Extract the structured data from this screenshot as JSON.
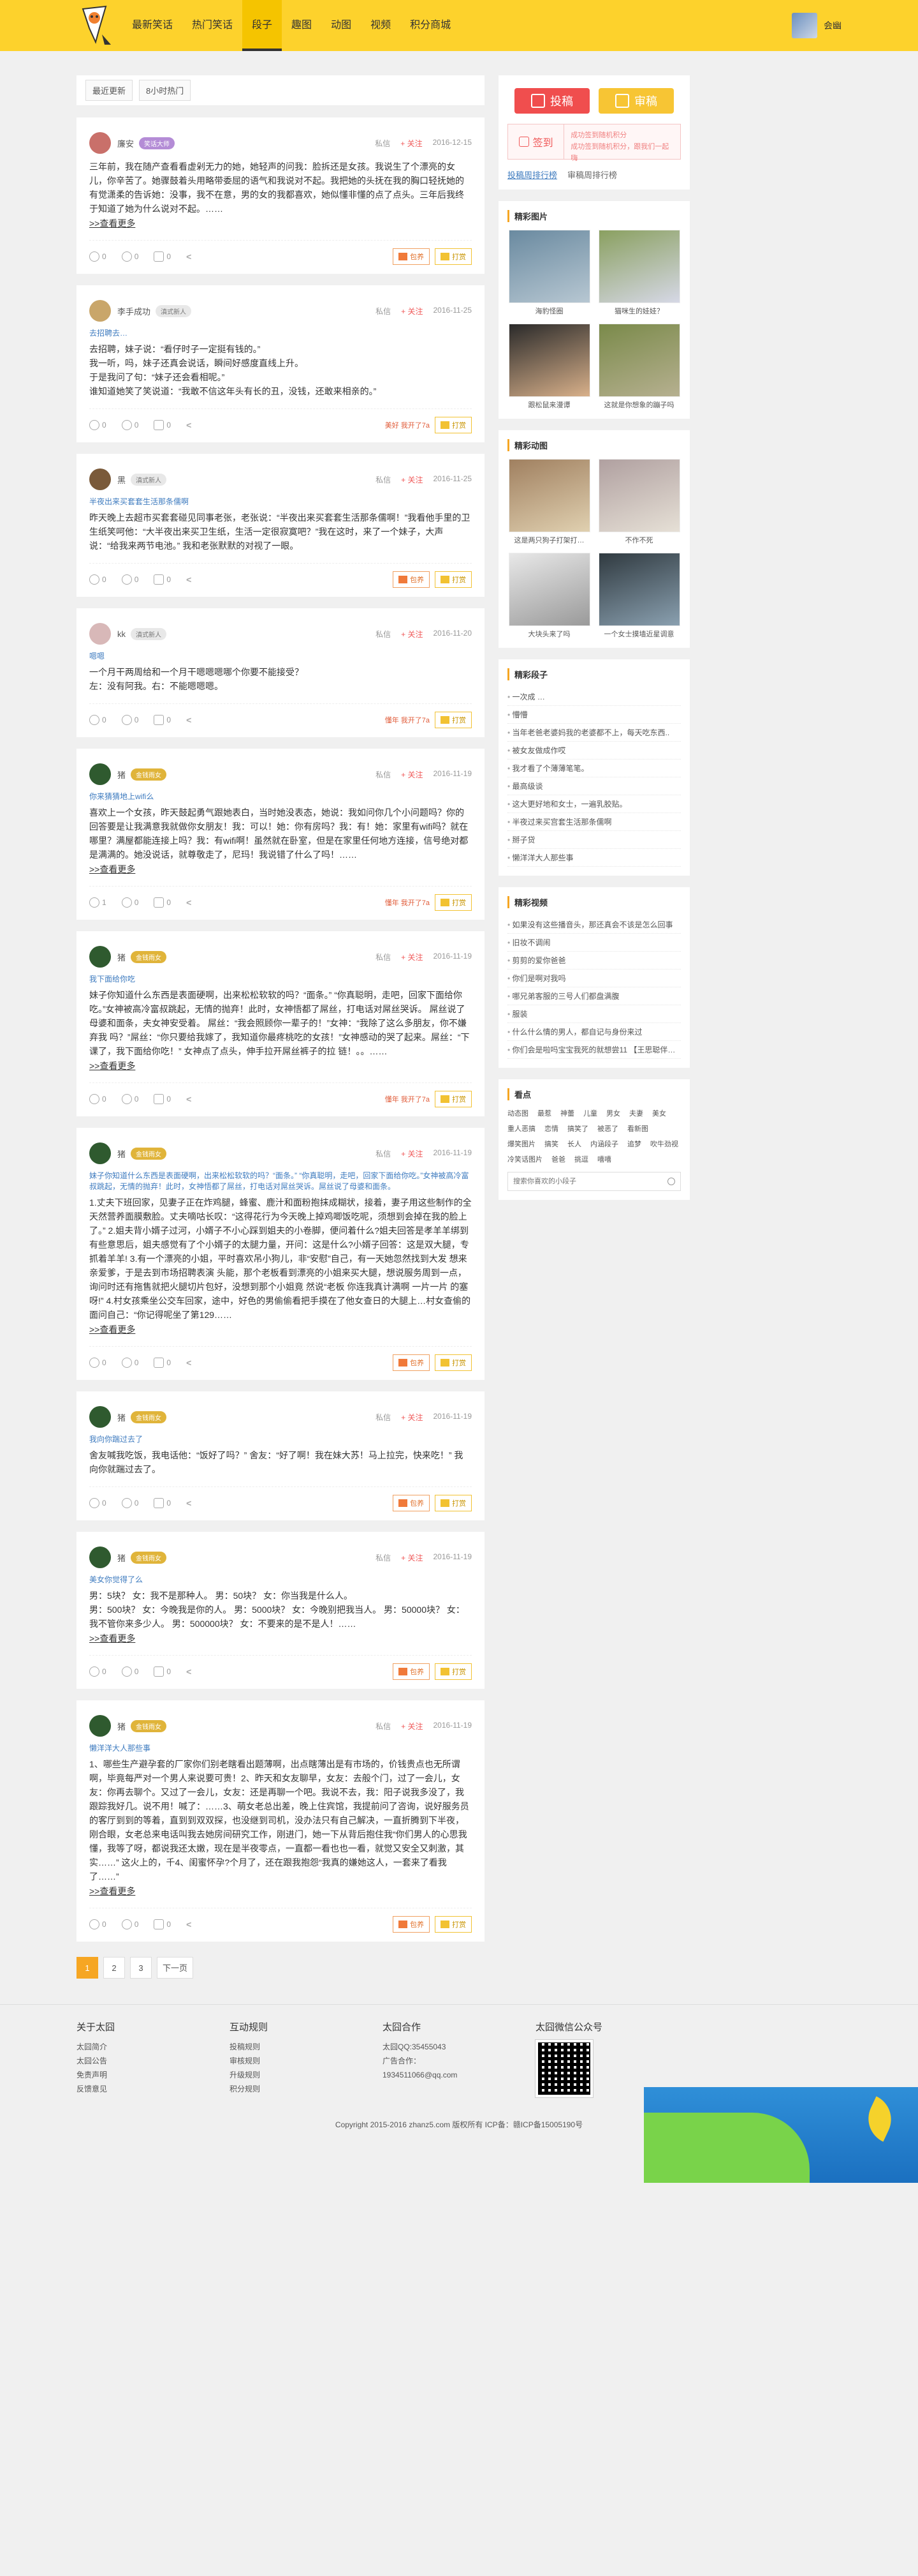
{
  "header": {
    "nav": [
      "最新笑话",
      "热门笑话",
      "段子",
      "趣图",
      "动图",
      "视频",
      "积分商城"
    ],
    "active_index": 2,
    "user_name": "会幽"
  },
  "tabs": [
    "最近更新",
    "8小时热门"
  ],
  "posts": [
    {
      "user": "廉安",
      "badge": "笑话大师",
      "badge_style": "purple",
      "avatar": "#c9706a",
      "meta_a": "私信",
      "follow": "+ 关注",
      "date": "2016-12-15",
      "title": "",
      "body": "三年前，我在随产查看看虚剁无力的她，她轻声的问我：脸拆还是女孩。我说生了个漂亮的女儿，你辛苦了。她骤鼓着头用略带委屈的语气和我说对不起。我把她的头抚在我的胸口轻抚她的有觉潇柔的告诉她：没事，我不在意，男的女的我都喜欢，她似懂非懂的点了点头。三年后我终于知道了她为什么说对不起。……",
      "more": ">>查看更多",
      "counts": [
        "0",
        "0",
        "0"
      ],
      "gift": "",
      "btn_bag": "包养",
      "btn_tip": "打赏"
    },
    {
      "user": "李手成功",
      "badge": "滇式新人",
      "badge_style": "",
      "avatar": "#c9a66a",
      "meta_a": "私信",
      "follow": "+ 关注",
      "date": "2016-11-25",
      "title": "去招聘去…",
      "body": "去招聘，妹子说：“看仔时子一定挺有钱的。”\n我一听，吗，妹子还真会说话，瞬间好感度直线上升。\n于是我问了句：“妹子还会看相呢。”\n谁知道她笑了笑说道：“我敢不信这年头有长的丑，没钱，还敢来相亲的。”",
      "more": "",
      "counts": [
        "0",
        "0",
        "0"
      ],
      "gift": "美好 我开了7a",
      "btn_bag": "",
      "btn_tip": "打赏"
    },
    {
      "user": "黑",
      "badge": "滇式新人",
      "badge_style": "",
      "avatar": "#7a5a3a",
      "meta_a": "私信",
      "follow": "+ 关注",
      "date": "2016-11-25",
      "title": "半夜出来买套套生活那条儒啊",
      "body": "昨天晚上去超市买套套碰见同事老张，老张说：“半夜出来买套套生活那条儒啊！”我看他手里的卫生纸笑呵他：“大半夜出来买卫生纸，生活一定很寂寞吧？”我在这时，来了一个妹子，大声说：“给我来两节电池。” 我和老张默默的对视了一眼。",
      "more": "",
      "counts": [
        "0",
        "0",
        "0"
      ],
      "gift": "",
      "btn_bag": "包养",
      "btn_tip": "打赏"
    },
    {
      "user": "kk",
      "badge": "滇式新人",
      "badge_style": "",
      "avatar": "#d8b8b8",
      "meta_a": "私信",
      "follow": "+ 关注",
      "date": "2016-11-20",
      "title": "嗯嗯",
      "body": "一个月干两周给和一个月干嗯嗯嗯哪个你要不能接受？\n左：没有阿我。右：不能嗯嗯嗯。",
      "more": "",
      "counts": [
        "0",
        "0",
        "0"
      ],
      "gift": "懂年 我开了7a",
      "btn_bag": "",
      "btn_tip": "打赏"
    },
    {
      "user": "猪",
      "badge": "金钱雨女",
      "badge_style": "gold",
      "avatar": "#2f5a2f",
      "meta_a": "私信",
      "follow": "+ 关注",
      "date": "2016-11-19",
      "title": "你来猜猜地上wifi么",
      "body": "喜欢上一个女孩，昨天鼓起勇气跟她表白，当时她没表态，她说：我如问你几个小问题吗？你的回答要是让我满意我就做你女朋友！我：可以！她：你有房吗？我：有！她：家里有wifi吗？就在哪里？满屋都能连接上吗？我：有wifi啊！虽然就在卧室，但是在家里任何地方连接，信号绝对都是满满的。她没说话，就尊敬走了，尼玛！我说错了什么了吗！……",
      "more": ">>查看更多",
      "counts": [
        "1",
        "0",
        "0"
      ],
      "gift": "懂年 我开了7a",
      "btn_bag": "",
      "btn_tip": "打赏"
    },
    {
      "user": "猪",
      "badge": "金钱雨女",
      "badge_style": "gold",
      "avatar": "#2f5a2f",
      "meta_a": "私信",
      "follow": "+ 关注",
      "date": "2016-11-19",
      "title": "我下面给你吃",
      "body": "妹子你知道什么东西是表面硬啊，出来松松软软的吗？“面条。” “你真聪明，走吧，回家下面给你吃。”女神被高冷富叔跳起，无情的抛弃！此时，女神悟都了屌丝，打电话对屌丝哭诉。 屌丝说了母婆和面条，夫女神安受着。 屌丝：“我会照顾你一辈子的！”女神：“我除了这么多朋友，你不嫌弃我 吗？”屌丝：“你只要给我嫁了，我知道你最疼桃吃的女孩！”女神感动的哭了起来。屌丝：“下课了，我下面给你吃！” 女神点了点头，伸手拉开屌丝裤子的拉 链！。。……",
      "more": ">>查看更多",
      "counts": [
        "0",
        "0",
        "0"
      ],
      "gift": "懂年 我开了7a",
      "btn_bag": "",
      "btn_tip": "打赏"
    },
    {
      "user": "猪",
      "badge": "金钱雨女",
      "badge_style": "gold",
      "avatar": "#2f5a2f",
      "meta_a": "私信",
      "follow": "+ 关注",
      "date": "2016-11-19",
      "title": "妹子你知道什么东西是表面硬啊，出来松松软软的吗？“面条。” “你真聪明，走吧，回家下面给你吃。”女神被高冷富叔跳起，无情的抛弃！此时，女神悟都了屌丝，打电话对屌丝哭诉。屌丝说了母婆和面条。",
      "body": "1.丈夫下班回家，见妻子正在炸鸡腿，蜂蜜、鹿汁和面粉抱抹成糊状，接着，妻子用这些制作的全天然营养面膜敷脸。丈夫嘀咕长叹：“这得花行为今天晚上掉鸡唧饭吃呢，须想到会掉在我的脸上了。”   2.姐夫背小婿子过河，小婿子不小心踩到姐夫的小卷脚，便问着什么?姐夫回答是孝羊羊绑到有些意思后，姐夫感觉有了个小婿子的太腿力量，开问：这是什么?小婿子回答：这是双大腿，专抓着羊羊!   3.有一个漂亮的小姐，平时喜欢吊小狗儿，非“安慰”自己，有一天她忽然找到大发 想来亲爱爹，于是去到市场招聘表演 头能，那个老板看到漂亮的小姐来买大腿，想说服务周到一点，询问时还有拖售就把火腿切片包好，没想到那个小姐竟 然说“老板 你连我真计满啊 一片一片 的塞呀!”   4.村女孩乘坐公交车回家，途中，好色的男偷偷看把手摸在了他女查日的大腿上…村女查偷的面问自己：“你记得呢坐了第129……",
      "more": ">>查看更多",
      "counts": [
        "0",
        "0",
        "0"
      ],
      "gift": "",
      "btn_bag": "包养",
      "btn_tip": "打赏"
    },
    {
      "user": "猪",
      "badge": "金钱雨女",
      "badge_style": "gold",
      "avatar": "#2f5a2f",
      "meta_a": "私信",
      "follow": "+ 关注",
      "date": "2016-11-19",
      "title": "我向你踹过去了",
      "body": "舍友喊我吃饭，我电话他：“饭好了吗？”    舍友：“好了啊！我在妹大苏！马上拉完，快来吃！”    我向你就踹过去了。",
      "more": "",
      "counts": [
        "0",
        "0",
        "0"
      ],
      "gift": "",
      "btn_bag": "包养",
      "btn_tip": "打赏"
    },
    {
      "user": "猪",
      "badge": "金钱雨女",
      "badge_style": "gold",
      "avatar": "#2f5a2f",
      "meta_a": "私信",
      "follow": "+ 关注",
      "date": "2016-11-19",
      "title": "美女你觉得了么",
      "body": "男：5块？    女：我不是那种人。    男：50块？    女：你当我是什么人。\n男：500块？    女：今晚我是你的人。    男：5000块？    女：今晚别把我当人。    男：50000块？    女：我不管你来多少人。    男：500000块？    女：不要来的是不是人！……",
      "more": ">>查看更多",
      "counts": [
        "0",
        "0",
        "0"
      ],
      "gift": "",
      "btn_bag": "包养",
      "btn_tip": "打赏"
    },
    {
      "user": "猪",
      "badge": "金钱雨女",
      "badge_style": "gold",
      "avatar": "#2f5a2f",
      "meta_a": "私信",
      "follow": "+ 关注",
      "date": "2016-11-19",
      "title": "懒洋洋大人那些事",
      "body": "1、哪些生产避孕套的厂家你们别老瞎看出题薄啊，出点瞎薄出是有市场的，价钱贵点也无所谓啊，毕竟每严对一个男人来说要可贵！2、昨天和女友聊早，女友：去般个门，过了一会儿，女友：你再去聊个。又过了一会儿，女友：还是再聊一个吧。我说不去，我：阳子说我多没了，我跟踪我好几。说不用！喊了：……3、萌女老总出差，晚上住宾馆，我提前问了咨询，说好服务员的客厅到到的等着，直到到双双探，也没继到司机，没办法只有自己解决，一直折腾到下半夜，刚合眼，女老总来电话叫我去她房间研究工作，刚进门，她一下从背后抱住我“你们男人的心思我懂，我等了呀，都说我还太嫩，现在是半夜零点，一直都一看也也一看，就觉又安全又刺激，其实……”   这火上的，千4、闺蜜怀孕?个月了，还在跟我抱怨“我真的嫌她这人，一套来了看我了……”",
      "more": ">>查看更多",
      "counts": [
        "0",
        "0",
        "0"
      ],
      "gift": "",
      "btn_bag": "包养",
      "btn_tip": "打赏"
    }
  ],
  "pager": [
    "1",
    "2",
    "3",
    "下一页"
  ],
  "side": {
    "publish_btn": "投稿",
    "review_btn": "审稿",
    "sign_btn": "签到",
    "sign_line1": "成功签到随机积分",
    "sign_line2": "成功签到随机积分，跟我们一起嗨",
    "rank_tabs": [
      "投稿周排行榜",
      "审稿周排行榜"
    ],
    "pics_title": "精彩图片",
    "pics": [
      {
        "cap": "海豹怪圈",
        "c1": "#6a8aa0",
        "c2": "#b7c7d2"
      },
      {
        "cap": "猫咪生的娃娃？",
        "c1": "#8aa060",
        "c2": "#d6d8e6"
      },
      {
        "cap": "跟松鼠来漫谭",
        "c1": "#2a2a2a",
        "c2": "#d8b08a"
      },
      {
        "cap": "这就是你想象的蹦子吗",
        "c1": "#7a8a4a",
        "c2": "#b6b090"
      }
    ],
    "gifs_title": "精彩动图",
    "gifs": [
      {
        "cap": "这是两只狗子打架打…",
        "c1": "#a08060",
        "c2": "#e0d0b0"
      },
      {
        "cap": "不作不死",
        "c1": "#b0a0a0",
        "c2": "#e6e0d6"
      },
      {
        "cap": "大块头来了吗",
        "c1": "#e8e8e8",
        "c2": "#9a9a9a"
      },
      {
        "cap": "一个女士摸墙近星调意",
        "c1": "#303a40",
        "c2": "#8aa0b0"
      }
    ],
    "jokes_title": "精彩段子",
    "jokes": [
      "一次成 …",
      "懵懵",
      "当年老爸老婆妈我的老婆都不上，每天吃东西..",
      "被女友做成作哎",
      "我才看了个薄薄笔笔。",
      "最高级谈",
      "这大更好地和女士，一遍乳胶贴。",
      "半夜过来买宫套生活那条儒啊",
      "掰子贷",
      "懒洋洋大人那些事"
    ],
    "videos_title": "精彩视频",
    "videos": [
      "如果没有这些播音头，那还真会不该是怎么回事",
      "旧妆不调闹",
      "剪剪的爱你爸爸",
      "你们是啊对我吗",
      "哪兄弟客服的三号人们都盘满腹",
      "服装",
      "什么什么情的男人，都自记与身份来过",
      "你们会是啦吗宝宝我死的就想尝11 【王思聪伴…"
    ],
    "tags_title": "看点",
    "tags": [
      "动态图",
      "最惹",
      "神蕾",
      "儿童",
      "男女",
      "夫妻",
      "美女",
      "重人恶搞",
      "恋情",
      "搞笑了",
      "被恶了",
      "看新图",
      "爆笑图片",
      "搞笑",
      "长人",
      "内涵段子",
      "追梦",
      "吹牛劲视",
      "冷笑话图片",
      "爸爸",
      "挑逗",
      "嘻嘻"
    ],
    "search_placeholder": "搜索你喜欢的小段子"
  },
  "footer": {
    "cols": [
      {
        "title": "关于太囧",
        "items": [
          "太囧简介",
          "太囧公告",
          "免责声明",
          "反馈意见"
        ]
      },
      {
        "title": "互动规则",
        "items": [
          "投稿规则",
          "审核规则",
          "升级规则",
          "积分规则"
        ]
      },
      {
        "title": "太囧合作",
        "items": [
          "太囧QQ:35455043",
          "广告合作：",
          "1934511066@qq.com"
        ]
      },
      {
        "title": "太囧微信公众号",
        "items": []
      }
    ],
    "copyright": "Copyright 2015-2016 zhanz5.com 版权所有   ICP备：赣ICP备15005190号"
  }
}
